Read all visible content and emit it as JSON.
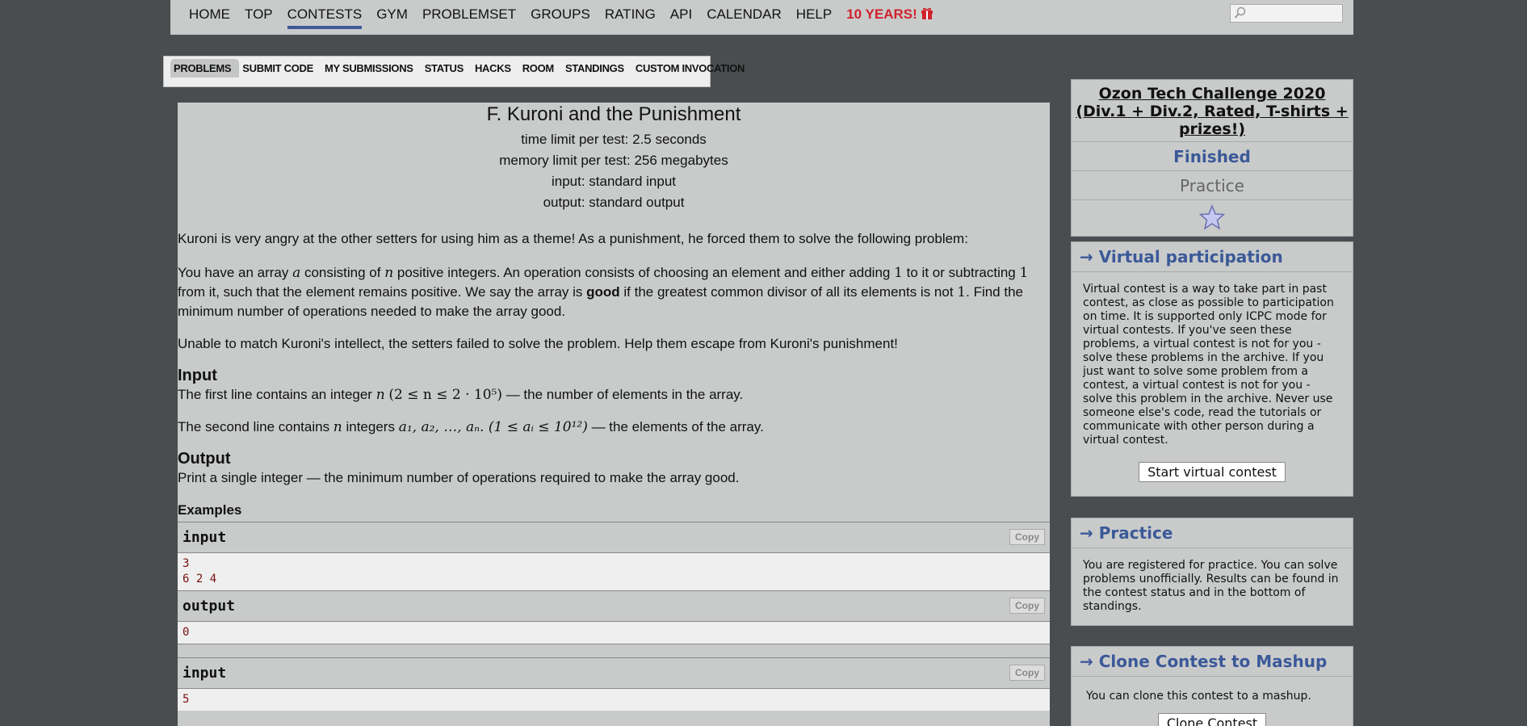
{
  "nav": {
    "items": [
      "HOME",
      "TOP",
      "CONTESTS",
      "GYM",
      "PROBLEMSET",
      "GROUPS",
      "RATING",
      "API",
      "CALENDAR",
      "HELP"
    ],
    "active": "CONTESTS",
    "promo": "10 YEARS!",
    "search_placeholder": ""
  },
  "subnav": {
    "items": [
      "PROBLEMS",
      "SUBMIT CODE",
      "MY SUBMISSIONS",
      "STATUS",
      "HACKS",
      "ROOM",
      "STANDINGS",
      "CUSTOM INVOCATION"
    ],
    "selected": "PROBLEMS"
  },
  "problem": {
    "title": "F. Kuroni and the Punishment",
    "time_limit": "time limit per test: 2.5 seconds",
    "memory_limit": "memory limit per test: 256 megabytes",
    "input_file": "input: standard input",
    "output_file": "output: standard output",
    "intro": "Kuroni is very angry at the other setters for using him as a theme! As a punishment, he forced them to solve the following problem:",
    "p1_a": "You have an array ",
    "p1_b": " consisting of ",
    "p1_c": " positive integers. An operation consists of choosing an element and either adding ",
    "p1_d": " to it or subtracting ",
    "p1_e": " from it, such that the element remains positive. We say the array is ",
    "p1_good": "good",
    "p1_f": " if the greatest common divisor of all its elements is not ",
    "p1_g": ". Find the minimum number of operations needed to make the array good.",
    "var_a": "a",
    "var_n": "n",
    "one": "1",
    "p2": "Unable to match Kuroni's intellect, the setters failed to solve the problem. Help them escape from Kuroni's punishment!",
    "input_heading": "Input",
    "input_1a": "The first line contains an integer ",
    "input_1_math": "(2 ≤ n ≤ 2 · 10⁵)",
    "input_1b": " — the number of elements in the array.",
    "input_2a": "The second line contains ",
    "input_2b": " integers ",
    "input_2_math": "a₁, a₂, …, aₙ. (1 ≤ aᵢ ≤ 10¹²)",
    "input_2c": " — the elements of the array.",
    "output_heading": "Output",
    "output_text": "Print a single integer  — the minimum number of operations required to make the array good.",
    "examples_heading": "Examples",
    "copy_label": "Copy",
    "input_label": "input",
    "output_label": "output",
    "ex1_input": [
      "3",
      "6 2 4"
    ],
    "ex1_output": [
      "0"
    ],
    "ex2_input": [
      "5"
    ]
  },
  "sidebar": {
    "contest_name": "Ozon Tech Challenge 2020 (Div.1 + Div.2, Rated, T-shirts + prizes!)",
    "status": "Finished",
    "mode": "Practice",
    "virtual_heading": "→ Virtual participation",
    "virtual_text": "Virtual contest is a way to take part in past contest, as close as possible to participation on time. It is supported only ICPC mode for virtual contests. If you've seen these problems, a virtual contest is not for you - solve these problems in the archive. If you just want to solve some problem from a contest, a virtual contest is not for you - solve this problem in the archive. Never use someone else's code, read the tutorials or communicate with other person during a virtual contest.",
    "virtual_button": "Start virtual contest",
    "practice_heading": "→ Practice",
    "practice_text": "You are registered for practice. You can solve problems unofficially. Results can be found in the contest status and in the bottom of standings.",
    "clone_heading": "→ Clone Contest to Mashup",
    "clone_text": "You can clone this contest to a mashup.",
    "clone_button": "Clone Contest"
  },
  "colors": {
    "accent": "#3b5998",
    "promo": "#d0222c",
    "background": "#4a4d4f",
    "panel": "#c9cbcb"
  }
}
